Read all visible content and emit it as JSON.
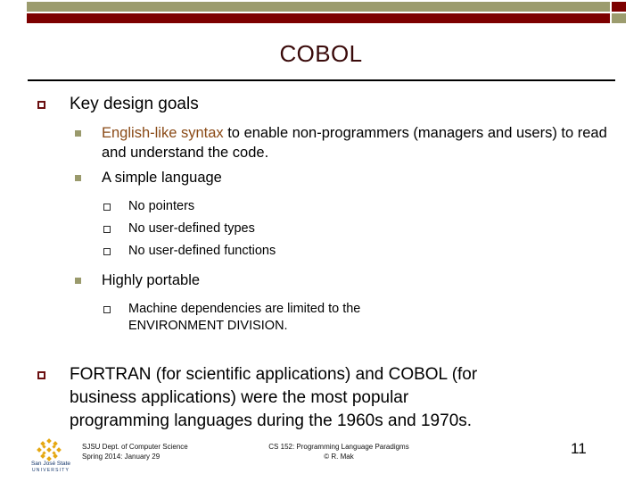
{
  "slide": {
    "title": "COBOL",
    "page_number": "11",
    "colors": {
      "bar_khaki": "#9c9c6e",
      "bar_dark_red": "#7d0000",
      "title_text": "#3a0a0a",
      "bullet_level1": "#6b0f10",
      "bullet_level2": "#9a9a6c",
      "highlight_text": "#8a4a16",
      "logo_gold": "#e5a812",
      "logo_blue": "#14366b"
    }
  },
  "content": {
    "items": [
      {
        "level": 1,
        "bullet": "square-hollow-dark-red",
        "text": "Key design goals"
      },
      {
        "level": 2,
        "bullet": "square-solid-khaki",
        "highlight": "English-like syntax",
        "text": " to enable non-programmers (managers and users) to read and understand the code."
      },
      {
        "level": 2,
        "bullet": "square-solid-khaki",
        "text": "A simple language"
      },
      {
        "level": 3,
        "bullet": "square-hollow-grey",
        "text": "No pointers"
      },
      {
        "level": 3,
        "bullet": "square-hollow-grey",
        "text": "No user-defined types"
      },
      {
        "level": 3,
        "bullet": "square-hollow-grey",
        "text": "No user-defined functions"
      },
      {
        "level": 2,
        "bullet": "square-solid-khaki",
        "text": "Highly portable"
      },
      {
        "level": 3,
        "bullet": "square-hollow-grey",
        "text": "Machine dependencies are limited to the ENVIRONMENT DIVISION."
      },
      {
        "level": 1,
        "bullet": "square-hollow-dark-red",
        "text": "FORTRAN (for scientific applications) and COBOL (for business applications) were the most popular programming languages during the 1960s and 1970s."
      }
    ]
  },
  "footer": {
    "logo": {
      "name": "San José State",
      "subtitle": "UNIVERSITY"
    },
    "left_line1": "SJSU Dept. of Computer Science",
    "left_line2": "Spring 2014: January 29",
    "center_line1": "CS 152: Programming Language Paradigms",
    "center_line2": "© R. Mak",
    "page_number": "11"
  }
}
